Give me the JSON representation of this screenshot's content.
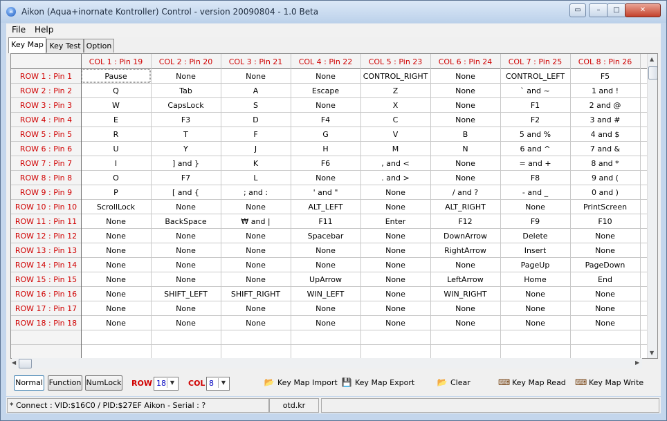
{
  "window": {
    "title": "Aikon (Aqua+inornate Kontroller) Control - version 20090804 - 1.0 Beta",
    "icon": "app-icon"
  },
  "menu": [
    "File",
    "Help"
  ],
  "tabs": [
    "Key Map",
    "Key Test",
    "Option"
  ],
  "grid": {
    "columns": [
      "COL 1 : Pin 19",
      "COL 2 : Pin 20",
      "COL 3 : Pin 21",
      "COL 4 : Pin 22",
      "COL 5 : Pin 23",
      "COL 6 : Pin 24",
      "COL 7 : Pin 25",
      "COL 8 : Pin 26"
    ],
    "rows": [
      {
        "label": "ROW 1 : Pin 1",
        "cells": [
          "Pause",
          "None",
          "None",
          "None",
          "CONTROL_RIGHT",
          "None",
          "CONTROL_LEFT",
          "F5"
        ]
      },
      {
        "label": "ROW 2 : Pin 2",
        "cells": [
          "Q",
          "Tab",
          "A",
          "Escape",
          "Z",
          "None",
          "` and ~",
          "1 and !"
        ]
      },
      {
        "label": "ROW 3 : Pin 3",
        "cells": [
          "W",
          "CapsLock",
          "S",
          "None",
          "X",
          "None",
          "F1",
          "2 and @"
        ]
      },
      {
        "label": "ROW 4 : Pin 4",
        "cells": [
          "E",
          "F3",
          "D",
          "F4",
          "C",
          "None",
          "F2",
          "3 and #"
        ]
      },
      {
        "label": "ROW 5 : Pin 5",
        "cells": [
          "R",
          "T",
          "F",
          "G",
          "V",
          "B",
          "5 and %",
          "4 and $"
        ]
      },
      {
        "label": "ROW 6 : Pin 6",
        "cells": [
          "U",
          "Y",
          "J",
          "H",
          "M",
          "N",
          "6 and ^",
          "7 and &"
        ]
      },
      {
        "label": "ROW 7 : Pin 7",
        "cells": [
          "I",
          "] and }",
          "K",
          "F6",
          ", and <",
          "None",
          "= and +",
          "8 and *"
        ]
      },
      {
        "label": "ROW 8 : Pin 8",
        "cells": [
          "O",
          "F7",
          "L",
          "None",
          ". and >",
          "None",
          "F8",
          "9 and ("
        ]
      },
      {
        "label": "ROW 9 : Pin 9",
        "cells": [
          "P",
          "[ and {",
          "; and :",
          "' and \"",
          "None",
          "/ and ?",
          "- and _",
          "0 and )"
        ]
      },
      {
        "label": "ROW 10 : Pin 10",
        "cells": [
          "ScrollLock",
          "None",
          "None",
          "ALT_LEFT",
          "None",
          "ALT_RIGHT",
          "None",
          "PrintScreen"
        ]
      },
      {
        "label": "ROW 11 : Pin 11",
        "cells": [
          "None",
          "BackSpace",
          "₩ and |",
          "F11",
          "Enter",
          "F12",
          "F9",
          "F10"
        ]
      },
      {
        "label": "ROW 12 : Pin 12",
        "cells": [
          "None",
          "None",
          "None",
          "Spacebar",
          "None",
          "DownArrow",
          "Delete",
          "None"
        ]
      },
      {
        "label": "ROW 13 : Pin 13",
        "cells": [
          "None",
          "None",
          "None",
          "None",
          "None",
          "RightArrow",
          "Insert",
          "None"
        ]
      },
      {
        "label": "ROW 14 : Pin 14",
        "cells": [
          "None",
          "None",
          "None",
          "None",
          "None",
          "None",
          "PageUp",
          "PageDown"
        ]
      },
      {
        "label": "ROW 15 : Pin 15",
        "cells": [
          "None",
          "None",
          "None",
          "UpArrow",
          "None",
          "LeftArrow",
          "Home",
          "End"
        ]
      },
      {
        "label": "ROW 16 : Pin 16",
        "cells": [
          "None",
          "SHIFT_LEFT",
          "SHIFT_RIGHT",
          "WIN_LEFT",
          "None",
          "WIN_RIGHT",
          "None",
          "None"
        ]
      },
      {
        "label": "ROW 17 : Pin 17",
        "cells": [
          "None",
          "None",
          "None",
          "None",
          "None",
          "None",
          "None",
          "None"
        ]
      },
      {
        "label": "ROW 18 : Pin 18",
        "cells": [
          "None",
          "None",
          "None",
          "None",
          "None",
          "None",
          "None",
          "None"
        ]
      }
    ],
    "header_color": "#d00000"
  },
  "toolbar": {
    "mode_buttons": [
      "Normal",
      "Function",
      "NumLock"
    ],
    "row_label": "ROW",
    "row_value": "18",
    "col_label": "COL",
    "col_value": "8",
    "actions": [
      "Key Map Import",
      "Key Map Export",
      "Clear",
      "Key Map Read",
      "Key Map Write"
    ]
  },
  "status": {
    "connection": "* Connect : VID:$16C0 / PID:$27EF Aikon - Serial : ?",
    "site": "otd.kr"
  }
}
